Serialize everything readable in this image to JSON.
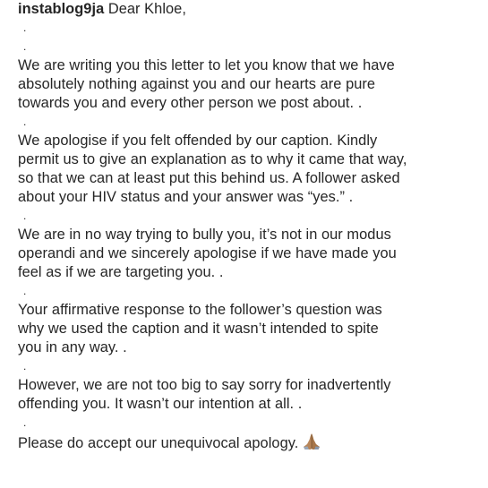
{
  "post": {
    "username": "instablog9ja",
    "greeting": " Dear Khloe,",
    "separator": ".",
    "paragraphs": [
      {
        "lines": [
          "We are writing you this letter to let you know that we have",
          "absolutely nothing against you and our hearts are pure",
          "towards you and every other person we post about. ."
        ]
      },
      {
        "lines": [
          "We apologise if you felt offended by our caption. Kindly",
          "permit us to give an explanation as to why it came that way,",
          "so that we can at least put this behind us. A follower asked",
          "about your HIV status and your answer was “yes.” ."
        ]
      },
      {
        "lines": [
          "We are in no way trying to bully you, it’s not in our modus",
          "operandi and we sincerely apologise if we have made you",
          "feel as if we are targeting you. ."
        ]
      },
      {
        "lines": [
          "Your affirmative response to the follower’s question was",
          "why we used the caption and it wasn’t intended to spite",
          "you in any way. ."
        ]
      },
      {
        "lines": [
          "However, we are not too big to say sorry for inadvertently",
          "offending you. It wasn’t our intention at all. ."
        ]
      },
      {
        "lines": [
          "Please do accept our unequivocal apology."
        ]
      }
    ],
    "closing_icon": "folded-hands-icon",
    "text_color": "#262626",
    "icon_color": "#b8865a"
  }
}
